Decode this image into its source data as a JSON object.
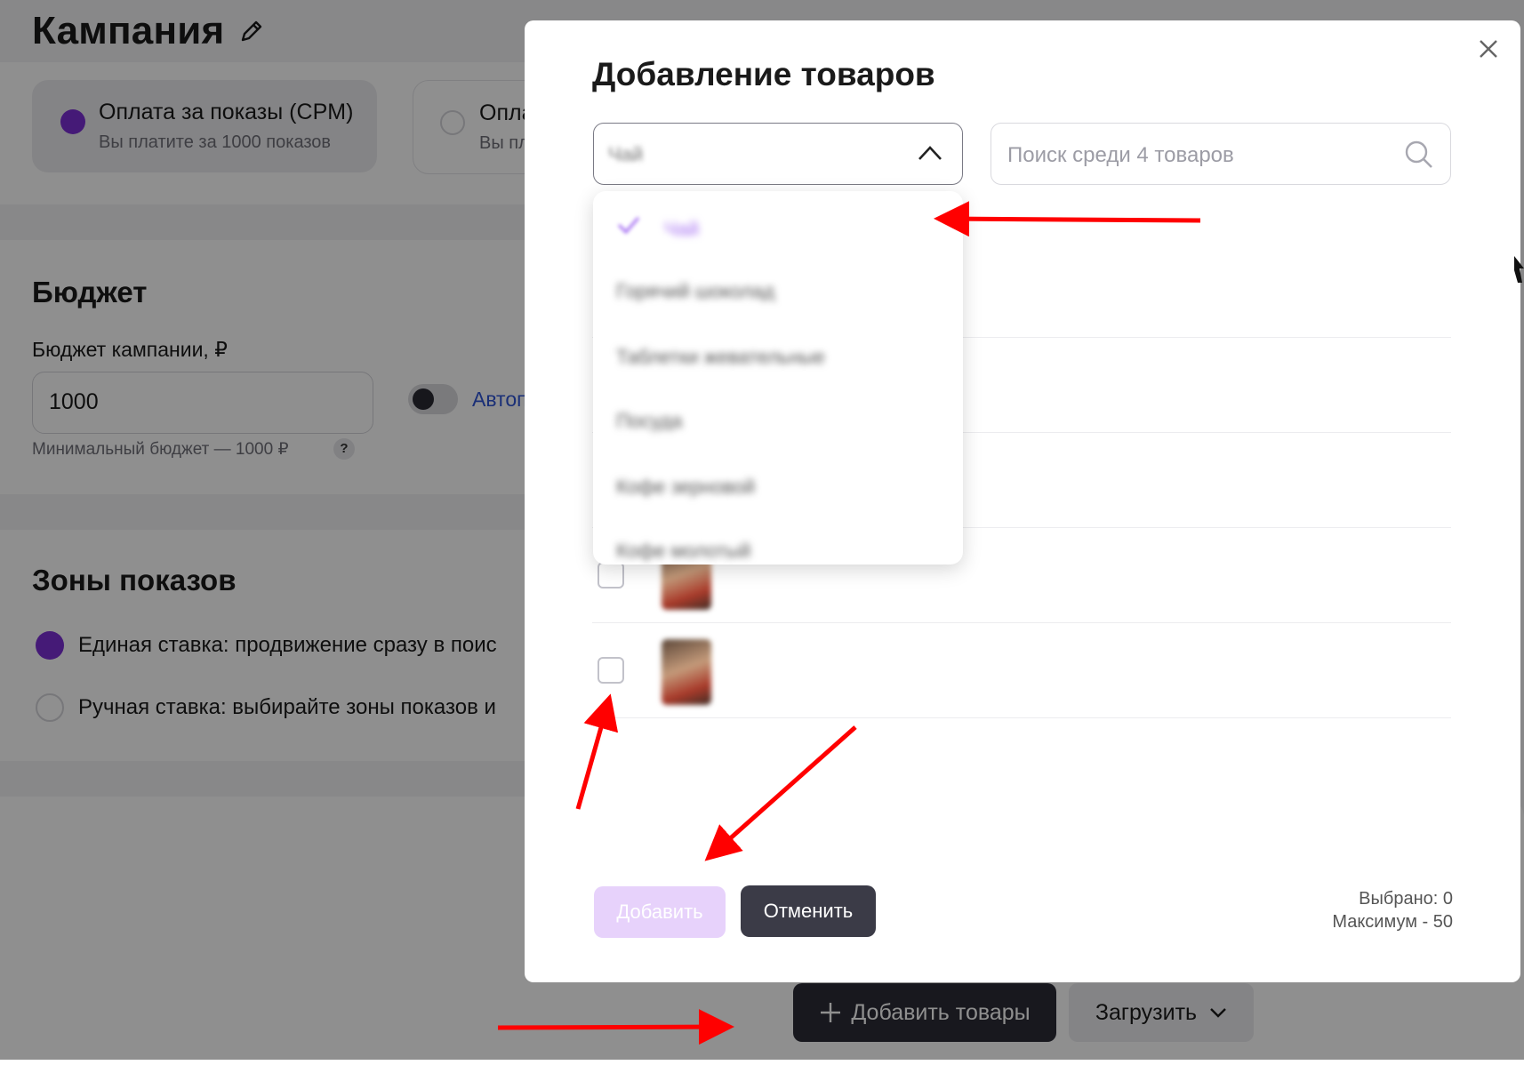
{
  "page": {
    "title": "Кампания",
    "payment": {
      "selected": {
        "title": "Оплата за показы (CPM)",
        "subtitle": "Вы платите за 1000 показов"
      },
      "other": {
        "title": "Опла",
        "subtitle": "Вы пл"
      }
    },
    "budget": {
      "heading": "Бюджет",
      "label": "Бюджет кампании, ₽",
      "value": "1000",
      "hint": "Минимальный бюджет — 1000 ₽",
      "hint_badge": "?",
      "auto_label": "Автоп"
    },
    "zones": {
      "heading": "Зоны показов",
      "option_single": "Единая ставка: продвижение сразу в поис",
      "option_manual": "Ручная ставка: выбирайте зоны показов и"
    },
    "bottom_bar": {
      "add_products_label": "Добавить товары",
      "upload_label": "Загрузить"
    }
  },
  "modal": {
    "title": "Добавление товаров",
    "category_select_value": "Чай",
    "search_placeholder": "Поиск среди 4 товаров",
    "dropdown_items": [
      {
        "label": "Чай",
        "selected": true
      },
      {
        "label": "Горячий шоколад",
        "selected": false
      },
      {
        "label": "Таблетки жевательные",
        "selected": false
      },
      {
        "label": "Посуда",
        "selected": false
      },
      {
        "label": "Кофе зерновой",
        "selected": false
      },
      {
        "label": "Кофе молотый",
        "selected": false
      }
    ],
    "products": [
      {
        "name": "",
        "desc": ""
      },
      {
        "name": "",
        "desc": ""
      },
      {
        "name": "",
        "desc": ""
      },
      {
        "name": "",
        "desc": ""
      },
      {
        "name": "",
        "desc": ""
      }
    ],
    "add_button_label": "Добавить",
    "cancel_button_label": "Отменить",
    "selected_count_label": "Выбрано: 0",
    "max_label": "Максимум - 50"
  },
  "colors": {
    "accent": "#7b2fd4",
    "add_disabled": "#e7d2fb",
    "dark_button": "#3b3b47",
    "annotation": "#ff0000"
  }
}
